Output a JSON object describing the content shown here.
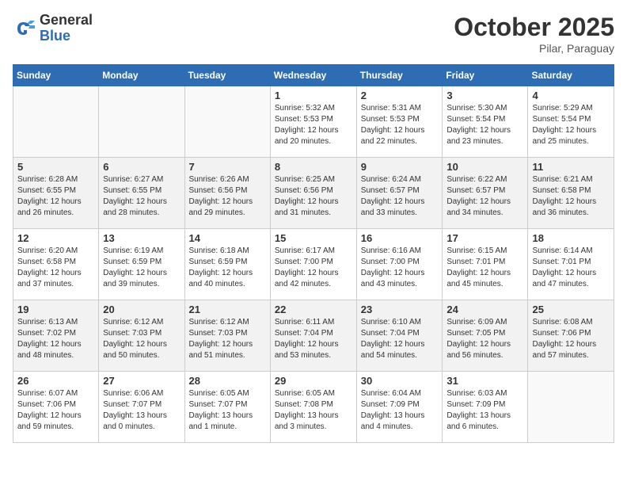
{
  "header": {
    "logo_general": "General",
    "logo_blue": "Blue",
    "month": "October 2025",
    "location": "Pilar, Paraguay"
  },
  "weekdays": [
    "Sunday",
    "Monday",
    "Tuesday",
    "Wednesday",
    "Thursday",
    "Friday",
    "Saturday"
  ],
  "weeks": [
    [
      {
        "num": "",
        "detail": ""
      },
      {
        "num": "",
        "detail": ""
      },
      {
        "num": "",
        "detail": ""
      },
      {
        "num": "1",
        "detail": "Sunrise: 5:32 AM\nSunset: 5:53 PM\nDaylight: 12 hours\nand 20 minutes."
      },
      {
        "num": "2",
        "detail": "Sunrise: 5:31 AM\nSunset: 5:53 PM\nDaylight: 12 hours\nand 22 minutes."
      },
      {
        "num": "3",
        "detail": "Sunrise: 5:30 AM\nSunset: 5:54 PM\nDaylight: 12 hours\nand 23 minutes."
      },
      {
        "num": "4",
        "detail": "Sunrise: 5:29 AM\nSunset: 5:54 PM\nDaylight: 12 hours\nand 25 minutes."
      }
    ],
    [
      {
        "num": "5",
        "detail": "Sunrise: 6:28 AM\nSunset: 6:55 PM\nDaylight: 12 hours\nand 26 minutes."
      },
      {
        "num": "6",
        "detail": "Sunrise: 6:27 AM\nSunset: 6:55 PM\nDaylight: 12 hours\nand 28 minutes."
      },
      {
        "num": "7",
        "detail": "Sunrise: 6:26 AM\nSunset: 6:56 PM\nDaylight: 12 hours\nand 29 minutes."
      },
      {
        "num": "8",
        "detail": "Sunrise: 6:25 AM\nSunset: 6:56 PM\nDaylight: 12 hours\nand 31 minutes."
      },
      {
        "num": "9",
        "detail": "Sunrise: 6:24 AM\nSunset: 6:57 PM\nDaylight: 12 hours\nand 33 minutes."
      },
      {
        "num": "10",
        "detail": "Sunrise: 6:22 AM\nSunset: 6:57 PM\nDaylight: 12 hours\nand 34 minutes."
      },
      {
        "num": "11",
        "detail": "Sunrise: 6:21 AM\nSunset: 6:58 PM\nDaylight: 12 hours\nand 36 minutes."
      }
    ],
    [
      {
        "num": "12",
        "detail": "Sunrise: 6:20 AM\nSunset: 6:58 PM\nDaylight: 12 hours\nand 37 minutes."
      },
      {
        "num": "13",
        "detail": "Sunrise: 6:19 AM\nSunset: 6:59 PM\nDaylight: 12 hours\nand 39 minutes."
      },
      {
        "num": "14",
        "detail": "Sunrise: 6:18 AM\nSunset: 6:59 PM\nDaylight: 12 hours\nand 40 minutes."
      },
      {
        "num": "15",
        "detail": "Sunrise: 6:17 AM\nSunset: 7:00 PM\nDaylight: 12 hours\nand 42 minutes."
      },
      {
        "num": "16",
        "detail": "Sunrise: 6:16 AM\nSunset: 7:00 PM\nDaylight: 12 hours\nand 43 minutes."
      },
      {
        "num": "17",
        "detail": "Sunrise: 6:15 AM\nSunset: 7:01 PM\nDaylight: 12 hours\nand 45 minutes."
      },
      {
        "num": "18",
        "detail": "Sunrise: 6:14 AM\nSunset: 7:01 PM\nDaylight: 12 hours\nand 47 minutes."
      }
    ],
    [
      {
        "num": "19",
        "detail": "Sunrise: 6:13 AM\nSunset: 7:02 PM\nDaylight: 12 hours\nand 48 minutes."
      },
      {
        "num": "20",
        "detail": "Sunrise: 6:12 AM\nSunset: 7:03 PM\nDaylight: 12 hours\nand 50 minutes."
      },
      {
        "num": "21",
        "detail": "Sunrise: 6:12 AM\nSunset: 7:03 PM\nDaylight: 12 hours\nand 51 minutes."
      },
      {
        "num": "22",
        "detail": "Sunrise: 6:11 AM\nSunset: 7:04 PM\nDaylight: 12 hours\nand 53 minutes."
      },
      {
        "num": "23",
        "detail": "Sunrise: 6:10 AM\nSunset: 7:04 PM\nDaylight: 12 hours\nand 54 minutes."
      },
      {
        "num": "24",
        "detail": "Sunrise: 6:09 AM\nSunset: 7:05 PM\nDaylight: 12 hours\nand 56 minutes."
      },
      {
        "num": "25",
        "detail": "Sunrise: 6:08 AM\nSunset: 7:06 PM\nDaylight: 12 hours\nand 57 minutes."
      }
    ],
    [
      {
        "num": "26",
        "detail": "Sunrise: 6:07 AM\nSunset: 7:06 PM\nDaylight: 12 hours\nand 59 minutes."
      },
      {
        "num": "27",
        "detail": "Sunrise: 6:06 AM\nSunset: 7:07 PM\nDaylight: 13 hours\nand 0 minutes."
      },
      {
        "num": "28",
        "detail": "Sunrise: 6:05 AM\nSunset: 7:07 PM\nDaylight: 13 hours\nand 1 minute."
      },
      {
        "num": "29",
        "detail": "Sunrise: 6:05 AM\nSunset: 7:08 PM\nDaylight: 13 hours\nand 3 minutes."
      },
      {
        "num": "30",
        "detail": "Sunrise: 6:04 AM\nSunset: 7:09 PM\nDaylight: 13 hours\nand 4 minutes."
      },
      {
        "num": "31",
        "detail": "Sunrise: 6:03 AM\nSunset: 7:09 PM\nDaylight: 13 hours\nand 6 minutes."
      },
      {
        "num": "",
        "detail": ""
      }
    ]
  ]
}
